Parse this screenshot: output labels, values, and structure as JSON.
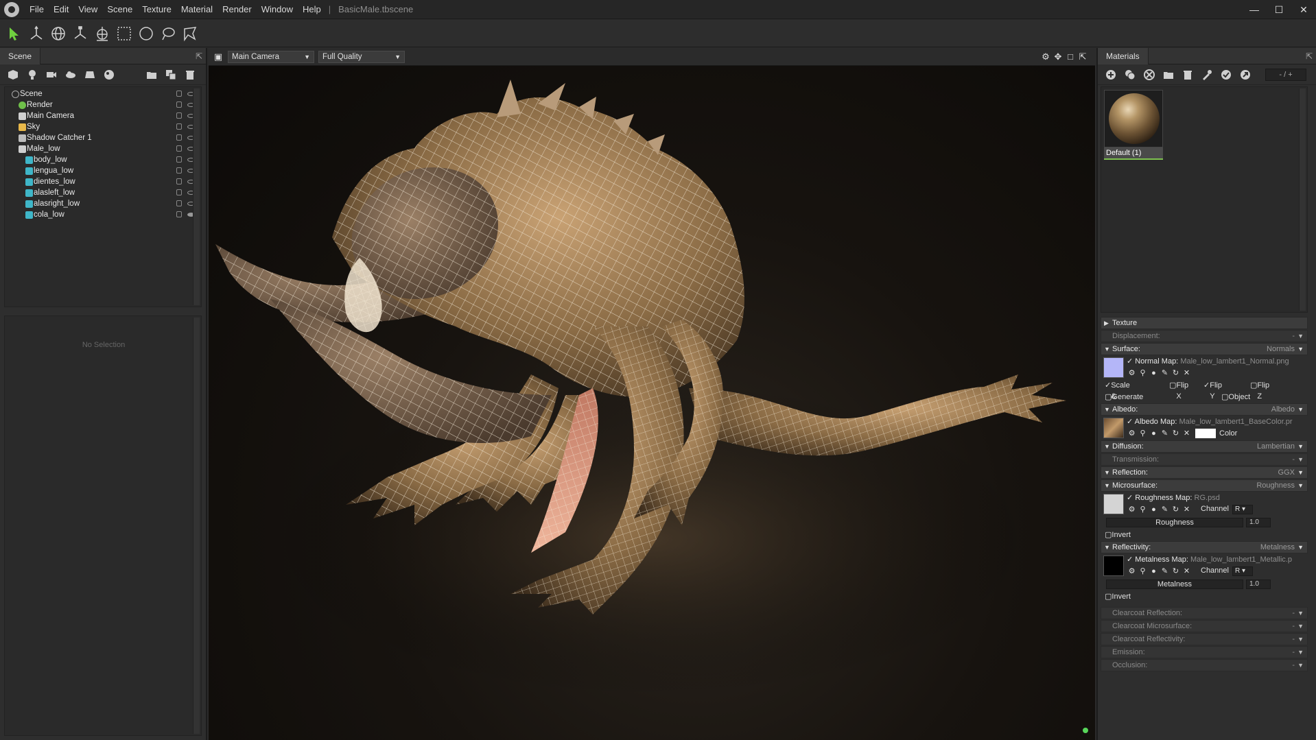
{
  "window": {
    "menu": [
      "File",
      "Edit",
      "View",
      "Scene",
      "Texture",
      "Material",
      "Render",
      "Window",
      "Help"
    ],
    "separator": "|",
    "filename": "BasicMale.tbscene",
    "controls": {
      "minimize": "—",
      "maximize": "☐",
      "close": "✕"
    }
  },
  "toolbar": {
    "tools": [
      "select-arrow-icon",
      "translate-icon",
      "rotate-icon",
      "scale-icon",
      "world-axis-icon",
      "rect-select-icon",
      "circle-select-icon",
      "lasso-icon",
      "paint-select-icon"
    ]
  },
  "scene_panel": {
    "tab": "Scene",
    "popout": "⇱",
    "icons": [
      "add-mesh-icon",
      "add-light-icon",
      "add-camera-icon",
      "add-sky-icon",
      "add-shadow-catcher-icon",
      "add-texture-icon",
      "folder-icon",
      "duplicate-icon",
      "trash-icon"
    ],
    "tree": [
      {
        "label": "Scene",
        "depth": 0,
        "icon": "scene-icon",
        "color": "#9a9a9a"
      },
      {
        "label": "Render",
        "depth": 1,
        "icon": "render-icon",
        "color": "#6fbf4a"
      },
      {
        "label": "Main Camera",
        "depth": 1,
        "icon": "camera-icon",
        "color": "#cfcfcf"
      },
      {
        "label": "Sky",
        "depth": 1,
        "icon": "sky-icon",
        "color": "#e8b84a"
      },
      {
        "label": "Shadow Catcher 1",
        "depth": 1,
        "icon": "shadow-catcher-icon",
        "color": "#bdbdbd"
      },
      {
        "label": "Male_low",
        "depth": 1,
        "icon": "model-icon",
        "color": "#cfcfcf"
      },
      {
        "label": "body_low",
        "depth": 2,
        "icon": "mesh-icon",
        "color": "#3fb6c8"
      },
      {
        "label": "lengua_low",
        "depth": 2,
        "icon": "mesh-icon",
        "color": "#3fb6c8"
      },
      {
        "label": "dientes_low",
        "depth": 2,
        "icon": "mesh-icon",
        "color": "#3fb6c8"
      },
      {
        "label": "alasleft_low",
        "depth": 2,
        "icon": "mesh-icon",
        "color": "#3fb6c8"
      },
      {
        "label": "alasright_low",
        "depth": 2,
        "icon": "mesh-icon",
        "color": "#3fb6c8"
      },
      {
        "label": "cola_low",
        "depth": 2,
        "icon": "mesh-icon",
        "color": "#3fb6c8"
      }
    ],
    "no_selection": "No Selection"
  },
  "viewport": {
    "camera": "Main Camera",
    "quality": "Full Quality",
    "icons": [
      "settings-icon",
      "move-view-icon",
      "frame-icon",
      "popout-icon"
    ]
  },
  "materials_panel": {
    "tab": "Materials",
    "popout": "⇱",
    "icons": [
      "new-material-icon",
      "duplicate-material-icon",
      "import-icon",
      "folder-icon",
      "trash-icon",
      "picker-icon",
      "apply-icon",
      "export-icon"
    ],
    "counter": "- / +",
    "thumbnail_label": "Default (1)",
    "texture_header": "Texture",
    "displacement": {
      "label": "Displacement:",
      "value": "-"
    },
    "surface": {
      "label": "Surface:",
      "value": "Normals"
    },
    "normal_map": {
      "label": "Normal Map:",
      "file": "Male_low_lambert1_Normal.png",
      "swatch": "#b4b6f8"
    },
    "normal_opts": {
      "scale_bias": "Scale & Bias",
      "flip_x": "Flip X",
      "flip_y": "Flip Y",
      "flip_z": "Flip Z",
      "generate_z": "Generate Z",
      "object_space": "Object Space"
    },
    "albedo": {
      "label": "Albedo:",
      "value": "Albedo"
    },
    "albedo_map": {
      "label": "Albedo Map:",
      "file": "Male_low_lambert1_BaseColor.pr",
      "color_label": "Color"
    },
    "diffusion": {
      "label": "Diffusion:",
      "value": "Lambertian"
    },
    "transmission": {
      "label": "Transmission:",
      "value": "-"
    },
    "reflection": {
      "label": "Reflection:",
      "value": "GGX"
    },
    "microsurface": {
      "label": "Microsurface:",
      "value": "Roughness"
    },
    "roughness_map": {
      "label": "Roughness Map:",
      "file": "RG.psd",
      "channel_label": "Channel",
      "channel": "R"
    },
    "roughness": {
      "label": "Roughness",
      "value": "1.0",
      "invert": "Invert"
    },
    "reflectivity": {
      "label": "Reflectivity:",
      "value": "Metalness"
    },
    "metalness_map": {
      "label": "Metalness Map:",
      "file": "Male_low_lambert1_Metallic.p",
      "channel_label": "Channel",
      "channel": "R"
    },
    "metalness": {
      "label": "Metalness",
      "value": "1.0",
      "invert": "Invert"
    },
    "extra": [
      {
        "label": "Clearcoat Reflection:",
        "value": "-"
      },
      {
        "label": "Clearcoat Microsurface:",
        "value": "-"
      },
      {
        "label": "Clearcoat Reflectivity:",
        "value": "-"
      },
      {
        "label": "Emission:",
        "value": "-"
      },
      {
        "label": "Occlusion:",
        "value": "-"
      }
    ]
  }
}
